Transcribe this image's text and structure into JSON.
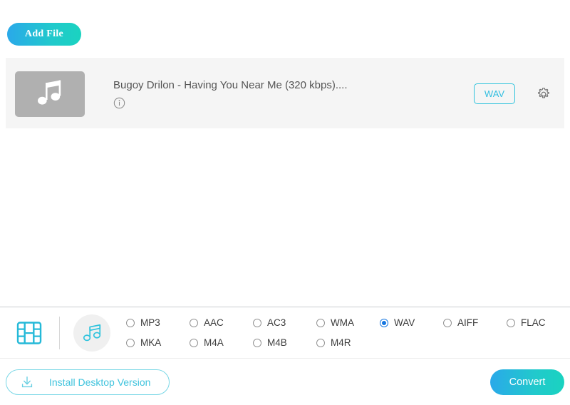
{
  "toolbar": {
    "add_file_label": "Add File"
  },
  "file_row": {
    "thumbnail_icon": "music-note-icon",
    "title": "Bugoy Drilon - Having You Near Me (320 kbps)....",
    "info_icon": "info-circle-icon",
    "output_format_badge": "WAV",
    "settings_icon": "gear-icon"
  },
  "format_bar": {
    "video_tab_icon": "film-strip-icon",
    "audio_tab_icon": "music-note-icon",
    "formats": [
      {
        "label": "MP3",
        "selected": false
      },
      {
        "label": "AAC",
        "selected": false
      },
      {
        "label": "AC3",
        "selected": false
      },
      {
        "label": "WMA",
        "selected": false
      },
      {
        "label": "WAV",
        "selected": true
      },
      {
        "label": "AIFF",
        "selected": false
      },
      {
        "label": "FLAC",
        "selected": false
      },
      {
        "label": "MKA",
        "selected": false
      },
      {
        "label": "M4A",
        "selected": false
      },
      {
        "label": "M4B",
        "selected": false
      },
      {
        "label": "M4R",
        "selected": false
      }
    ]
  },
  "footer": {
    "install_label": "Install Desktop Version",
    "install_icon": "download-icon",
    "convert_label": "Convert"
  },
  "colors": {
    "accent_cyan": "#33bfe0",
    "gradient_start": "#2aa9e9",
    "gradient_end": "#1ad3c0",
    "radio_selected_blue": "#1576e0",
    "row_background": "#f5f5f5"
  }
}
